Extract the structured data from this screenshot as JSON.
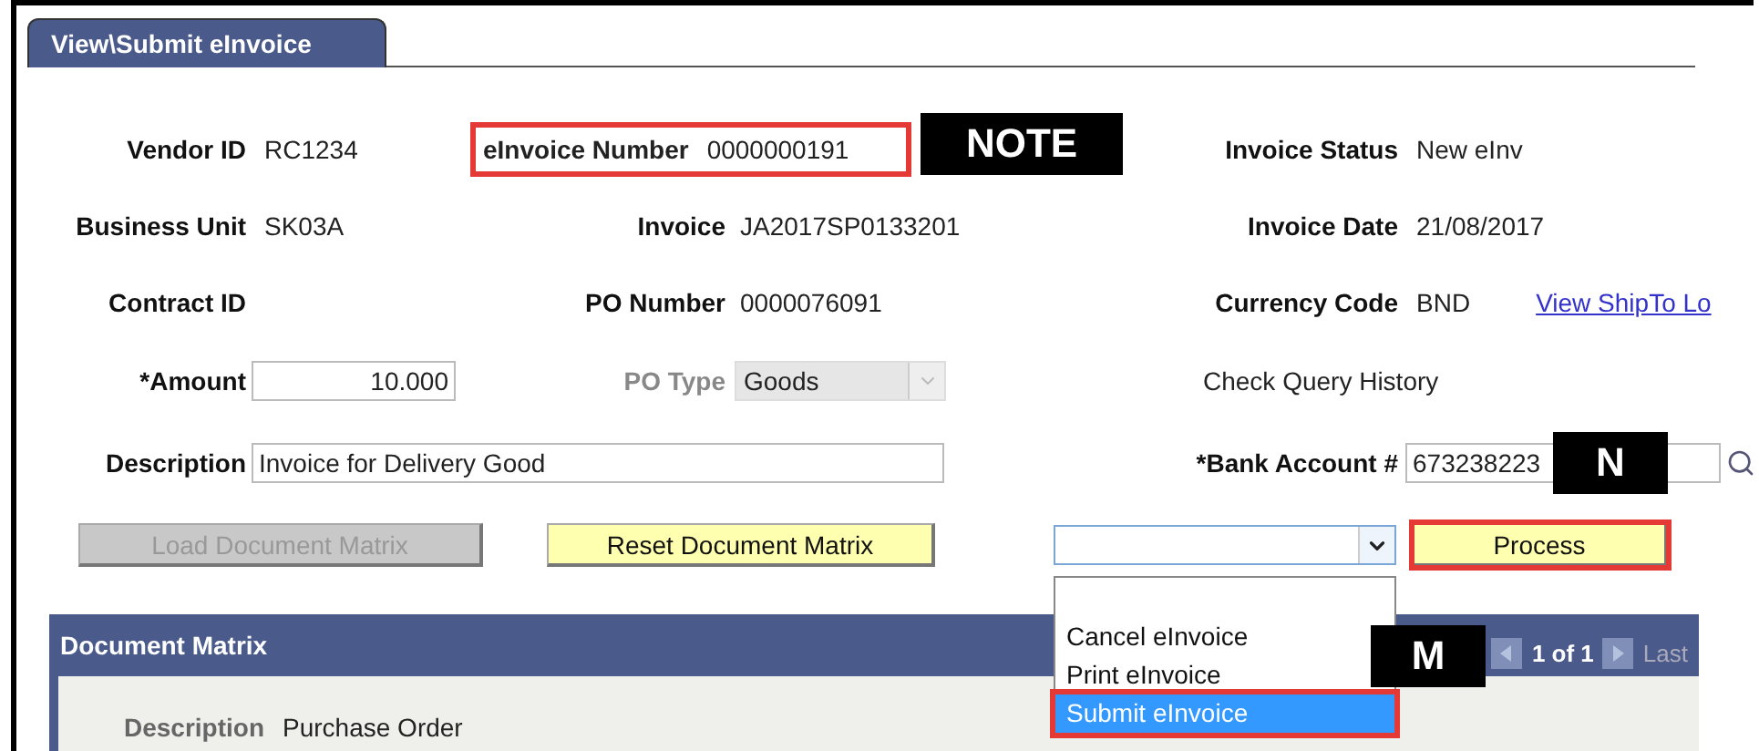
{
  "tab": {
    "label": "View\\Submit eInvoice",
    "selected": true
  },
  "vendor_id": {
    "label": "Vendor ID",
    "value": "RC1234"
  },
  "einvoice_number": {
    "label": "eInvoice Number",
    "value": "0000000191",
    "highlighted": true
  },
  "invoice_status": {
    "label": "Invoice Status",
    "value": "New eInv"
  },
  "business_unit": {
    "label": "Business Unit",
    "value": "SK03A"
  },
  "invoice": {
    "label": "Invoice",
    "value": "JA2017SP0133201"
  },
  "invoice_date": {
    "label": "Invoice Date",
    "value": "21/08/2017"
  },
  "contract_id": {
    "label": "Contract ID"
  },
  "po_number": {
    "label": "PO Number",
    "value": "0000076091"
  },
  "currency_code": {
    "label": "Currency Code",
    "value": "BND"
  },
  "ship_to_link": "View ShipTo Lo",
  "amount": {
    "label": "*Amount",
    "value": "10.000"
  },
  "po_type": {
    "label": "PO Type",
    "value": "Goods",
    "disabled": true
  },
  "check_query_history": "Check Query History",
  "description": {
    "label": "Description",
    "value": "Invoice for Delivery Good"
  },
  "bank_account": {
    "label": "*Bank Account #",
    "value": "673238223"
  },
  "buttons": [
    {
      "label": "Load Document Matrix",
      "disabled": true,
      "highlighted": false
    },
    {
      "label": "Reset Document Matrix",
      "disabled": false,
      "highlighted": false
    }
  ],
  "action_select": {
    "expanded": true,
    "options": [
      {
        "label": "Cancel eInvoice",
        "selected": false,
        "highlighted": false
      },
      {
        "label": "Print eInvoice",
        "selected": false,
        "highlighted": false
      },
      {
        "label": "Submit eInvoice",
        "selected": true,
        "highlighted": true
      }
    ]
  },
  "process_button": {
    "label": "Process",
    "highlighted": true
  },
  "document_matrix": {
    "title": "Document Matrix",
    "pager": "1 of 1",
    "last": "Last",
    "description": {
      "label": "Description",
      "value": "Purchase Order"
    }
  },
  "annotations": [
    {
      "text": "NOTE"
    },
    {
      "text": "N"
    },
    {
      "text": "M"
    }
  ]
}
